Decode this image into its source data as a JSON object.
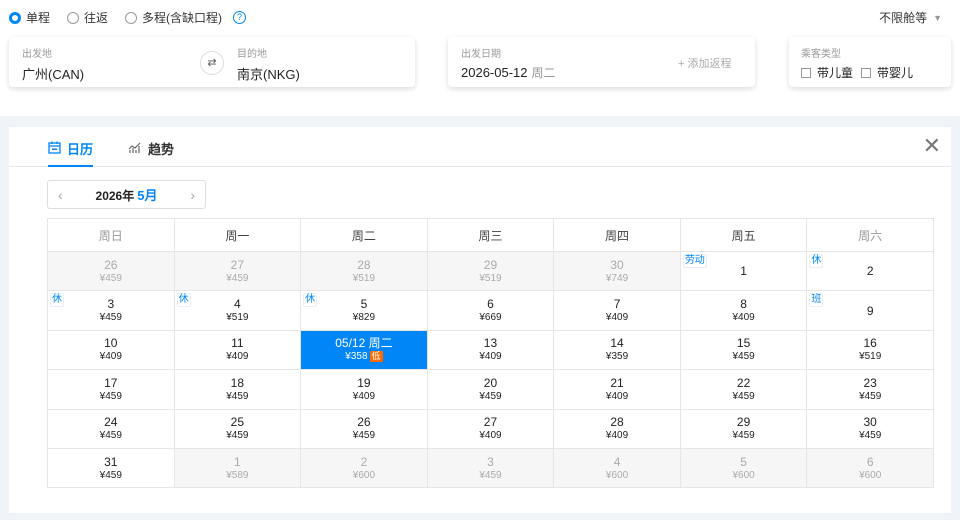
{
  "trip_types": [
    {
      "label": "单程",
      "selected": true
    },
    {
      "label": "往返",
      "selected": false
    },
    {
      "label": "多程(含缺口程)",
      "selected": false
    }
  ],
  "help_glyph": "?",
  "cabin": {
    "label": "不限舱等"
  },
  "route": {
    "from_label": "出发地",
    "from_value": "广州(CAN)",
    "to_label": "目的地",
    "to_value": "南京(NKG)",
    "swap_glyph": "⇄"
  },
  "date_box": {
    "label": "出发日期",
    "date": "2026-05-12",
    "weekday": "周二",
    "add_return": "+ 添加返程"
  },
  "passenger": {
    "label": "乘客类型",
    "child": "带儿童",
    "infant": "带婴儿"
  },
  "calendar": {
    "tabs": [
      {
        "label": "日历",
        "icon": "calendar-icon",
        "active": true
      },
      {
        "label": "趋势",
        "icon": "trend-chart-icon",
        "active": false
      }
    ],
    "close_glyph": "✕",
    "year_label": "2026年",
    "month_label": "5月",
    "prev_glyph": "‹",
    "next_glyph": "›",
    "weekdays": [
      "周日",
      "周一",
      "周二",
      "周三",
      "周四",
      "周五",
      "周六"
    ],
    "rows": [
      [
        {
          "day": "26",
          "price": "¥459",
          "dim": true
        },
        {
          "day": "27",
          "price": "¥459",
          "dim": true
        },
        {
          "day": "28",
          "price": "¥519",
          "dim": true
        },
        {
          "day": "29",
          "price": "¥519",
          "dim": true
        },
        {
          "day": "30",
          "price": "¥749",
          "dim": true
        },
        {
          "day": "1",
          "price": "",
          "tag": "劳动"
        },
        {
          "day": "2",
          "price": "",
          "tag": "休"
        }
      ],
      [
        {
          "day": "3",
          "price": "¥459",
          "tag": "休"
        },
        {
          "day": "4",
          "price": "¥519",
          "tag": "休"
        },
        {
          "day": "5",
          "price": "¥829",
          "tag": "休"
        },
        {
          "day": "6",
          "price": "¥669"
        },
        {
          "day": "7",
          "price": "¥409"
        },
        {
          "day": "8",
          "price": "¥409"
        },
        {
          "day": "9",
          "price": "",
          "tag": "班"
        }
      ],
      [
        {
          "day": "10",
          "price": "¥409"
        },
        {
          "day": "11",
          "price": "¥409"
        },
        {
          "day": "05/12 周二",
          "price": "¥358",
          "selected": true,
          "low": "低"
        },
        {
          "day": "13",
          "price": "¥409"
        },
        {
          "day": "14",
          "price": "¥359"
        },
        {
          "day": "15",
          "price": "¥459"
        },
        {
          "day": "16",
          "price": "¥519"
        }
      ],
      [
        {
          "day": "17",
          "price": "¥459"
        },
        {
          "day": "18",
          "price": "¥459"
        },
        {
          "day": "19",
          "price": "¥409"
        },
        {
          "day": "20",
          "price": "¥459"
        },
        {
          "day": "21",
          "price": "¥409"
        },
        {
          "day": "22",
          "price": "¥459"
        },
        {
          "day": "23",
          "price": "¥459"
        }
      ],
      [
        {
          "day": "24",
          "price": "¥459"
        },
        {
          "day": "25",
          "price": "¥459"
        },
        {
          "day": "26",
          "price": "¥459"
        },
        {
          "day": "27",
          "price": "¥409"
        },
        {
          "day": "28",
          "price": "¥409"
        },
        {
          "day": "29",
          "price": "¥459"
        },
        {
          "day": "30",
          "price": "¥459"
        }
      ],
      [
        {
          "day": "31",
          "price": "¥459"
        },
        {
          "day": "1",
          "price": "¥589",
          "dim": true
        },
        {
          "day": "2",
          "price": "¥600",
          "dim": true
        },
        {
          "day": "3",
          "price": "¥459",
          "dim": true
        },
        {
          "day": "4",
          "price": "¥600",
          "dim": true
        },
        {
          "day": "5",
          "price": "¥600",
          "dim": true
        },
        {
          "day": "6",
          "price": "¥600",
          "dim": true
        }
      ]
    ]
  },
  "colors": {
    "accent": "#0086f6",
    "low_badge": "#ff6a00",
    "dim_cell": "#f6f6f6"
  }
}
